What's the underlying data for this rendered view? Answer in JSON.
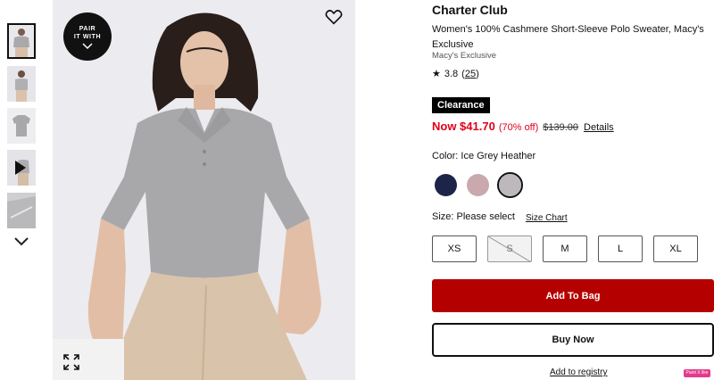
{
  "gallery": {
    "pair_badge": {
      "line1": "PAIR",
      "line2": "IT WITH"
    },
    "icons": {
      "wishlist": "heart-icon",
      "expand": "expand-icon",
      "scroll_down": "chevron-down-icon",
      "video": "play-icon"
    }
  },
  "product": {
    "brand": "Charter Club",
    "title": "Women's 100% Cashmere Short-Sleeve Polo Sweater, Macy's Exclusive",
    "exclusive": "Macy's Exclusive",
    "rating": {
      "star": "★",
      "value": "3.8",
      "count": "25"
    }
  },
  "pricing": {
    "badge": "Clearance",
    "now": "Now $41.70",
    "percent_off": "(70% off)",
    "original": "$139.00",
    "details_link": "Details",
    "accent_color": "#e0001b"
  },
  "color": {
    "label": "Color: Ice Grey Heather",
    "swatches": [
      {
        "name": "Navy",
        "hex": "#1c2448"
      },
      {
        "name": "Pink Heather",
        "hex": "#c9a9ad"
      },
      {
        "name": "Ice Grey Heather",
        "hex": "#bdb8bc",
        "selected": true
      }
    ]
  },
  "size": {
    "label": "Size: Please select",
    "chart_link": "Size Chart",
    "options": [
      {
        "label": "XS",
        "available": true
      },
      {
        "label": "S",
        "available": false
      },
      {
        "label": "M",
        "available": true
      },
      {
        "label": "L",
        "available": true
      },
      {
        "label": "XL",
        "available": true
      }
    ]
  },
  "actions": {
    "add_to_bag": "Add To Bag",
    "buy_now": "Buy Now",
    "registry": "Add to registry",
    "add_color": "#b50000"
  },
  "extension_badge": "Paint X like"
}
